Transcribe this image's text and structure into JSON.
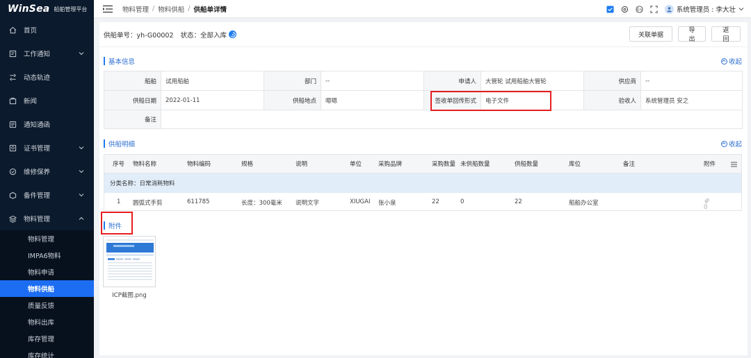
{
  "brand": {
    "logo": "WinSea",
    "subtitle": "船舶管理平台"
  },
  "sidebar": {
    "items": [
      {
        "label": "首页",
        "icon": "home-icon",
        "has_children": false
      },
      {
        "label": "工作通知",
        "icon": "notice-icon",
        "has_children": true
      },
      {
        "label": "动态轨迹",
        "icon": "track-icon",
        "has_children": false
      },
      {
        "label": "新闻",
        "icon": "news-icon",
        "has_children": false
      },
      {
        "label": "通知通函",
        "icon": "circular-icon",
        "has_children": false
      },
      {
        "label": "证书管理",
        "icon": "certificate-icon",
        "has_children": true
      },
      {
        "label": "维修保养",
        "icon": "maintenance-icon",
        "has_children": true
      },
      {
        "label": "备件管理",
        "icon": "spare-parts-icon",
        "has_children": true
      },
      {
        "label": "物料管理",
        "icon": "material-icon",
        "has_children": true,
        "expanded": true
      }
    ],
    "submenu": [
      {
        "label": "物料管理",
        "active": false
      },
      {
        "label": "IMPA6物料",
        "active": false
      },
      {
        "label": "物料申请",
        "active": false
      },
      {
        "label": "物料供船",
        "active": true
      },
      {
        "label": "质量反馈",
        "active": false
      },
      {
        "label": "物料出库",
        "active": false
      },
      {
        "label": "库存管理",
        "active": false
      },
      {
        "label": "库存统计",
        "active": false
      }
    ]
  },
  "topbar": {
    "breadcrumb": [
      "物料管理",
      "物料供船",
      "供船单详情"
    ],
    "user": "系统管理员 : 李大壮"
  },
  "order": {
    "number": "供船单号：yh-G00002",
    "status": "状态：全部入库"
  },
  "actions": {
    "related": "关联单据",
    "export": "导出",
    "back": "返回"
  },
  "basic_info": {
    "title": "基本信息",
    "collapse": "收起",
    "rows": [
      [
        {
          "label": "船舶",
          "value": "试用船舶"
        },
        {
          "label": "部门",
          "value": "--"
        },
        {
          "label": "申请人",
          "value": "大管轮 试用船舶大管轮"
        },
        {
          "label": "供应商",
          "value": "--"
        }
      ],
      [
        {
          "label": "供船日期",
          "value": "2022-01-11"
        },
        {
          "label": "供船地点",
          "value": "嗯嗯"
        },
        {
          "label": "签收单回传形式",
          "value": "电子文件"
        },
        {
          "label": "验收人",
          "value": "系统管理员 安之"
        }
      ],
      [
        {
          "label": "备注",
          "value": ""
        }
      ]
    ]
  },
  "supply_detail": {
    "title": "供船明细",
    "collapse": "收起",
    "columns": [
      "序号",
      "物料名称",
      "物料编码",
      "规格",
      "说明",
      "单位",
      "采购品牌",
      "采购数量",
      "未供船数量",
      "供船数量",
      "库位",
      "备注",
      "附件"
    ],
    "category": "分类名称：日常消耗物料",
    "rows": [
      {
        "index": "1",
        "name": "圆弧式手剪",
        "code": "611785",
        "spec": "长度：300毫米",
        "desc": "说明文字",
        "unit": "XIUGAI",
        "brand": "张小泉",
        "purchase_qty": "22",
        "pending_qty": "0",
        "supply_qty": "22",
        "location": "船舶办公室",
        "remark": "",
        "attach_count": "0"
      }
    ]
  },
  "attachments": {
    "title": "附件",
    "files": [
      {
        "name": "ICP截图.png"
      }
    ]
  },
  "colors": {
    "accent": "#1c7cf0",
    "sidebar_bg": "#0b1a2c",
    "highlight": "#e61e1e"
  }
}
